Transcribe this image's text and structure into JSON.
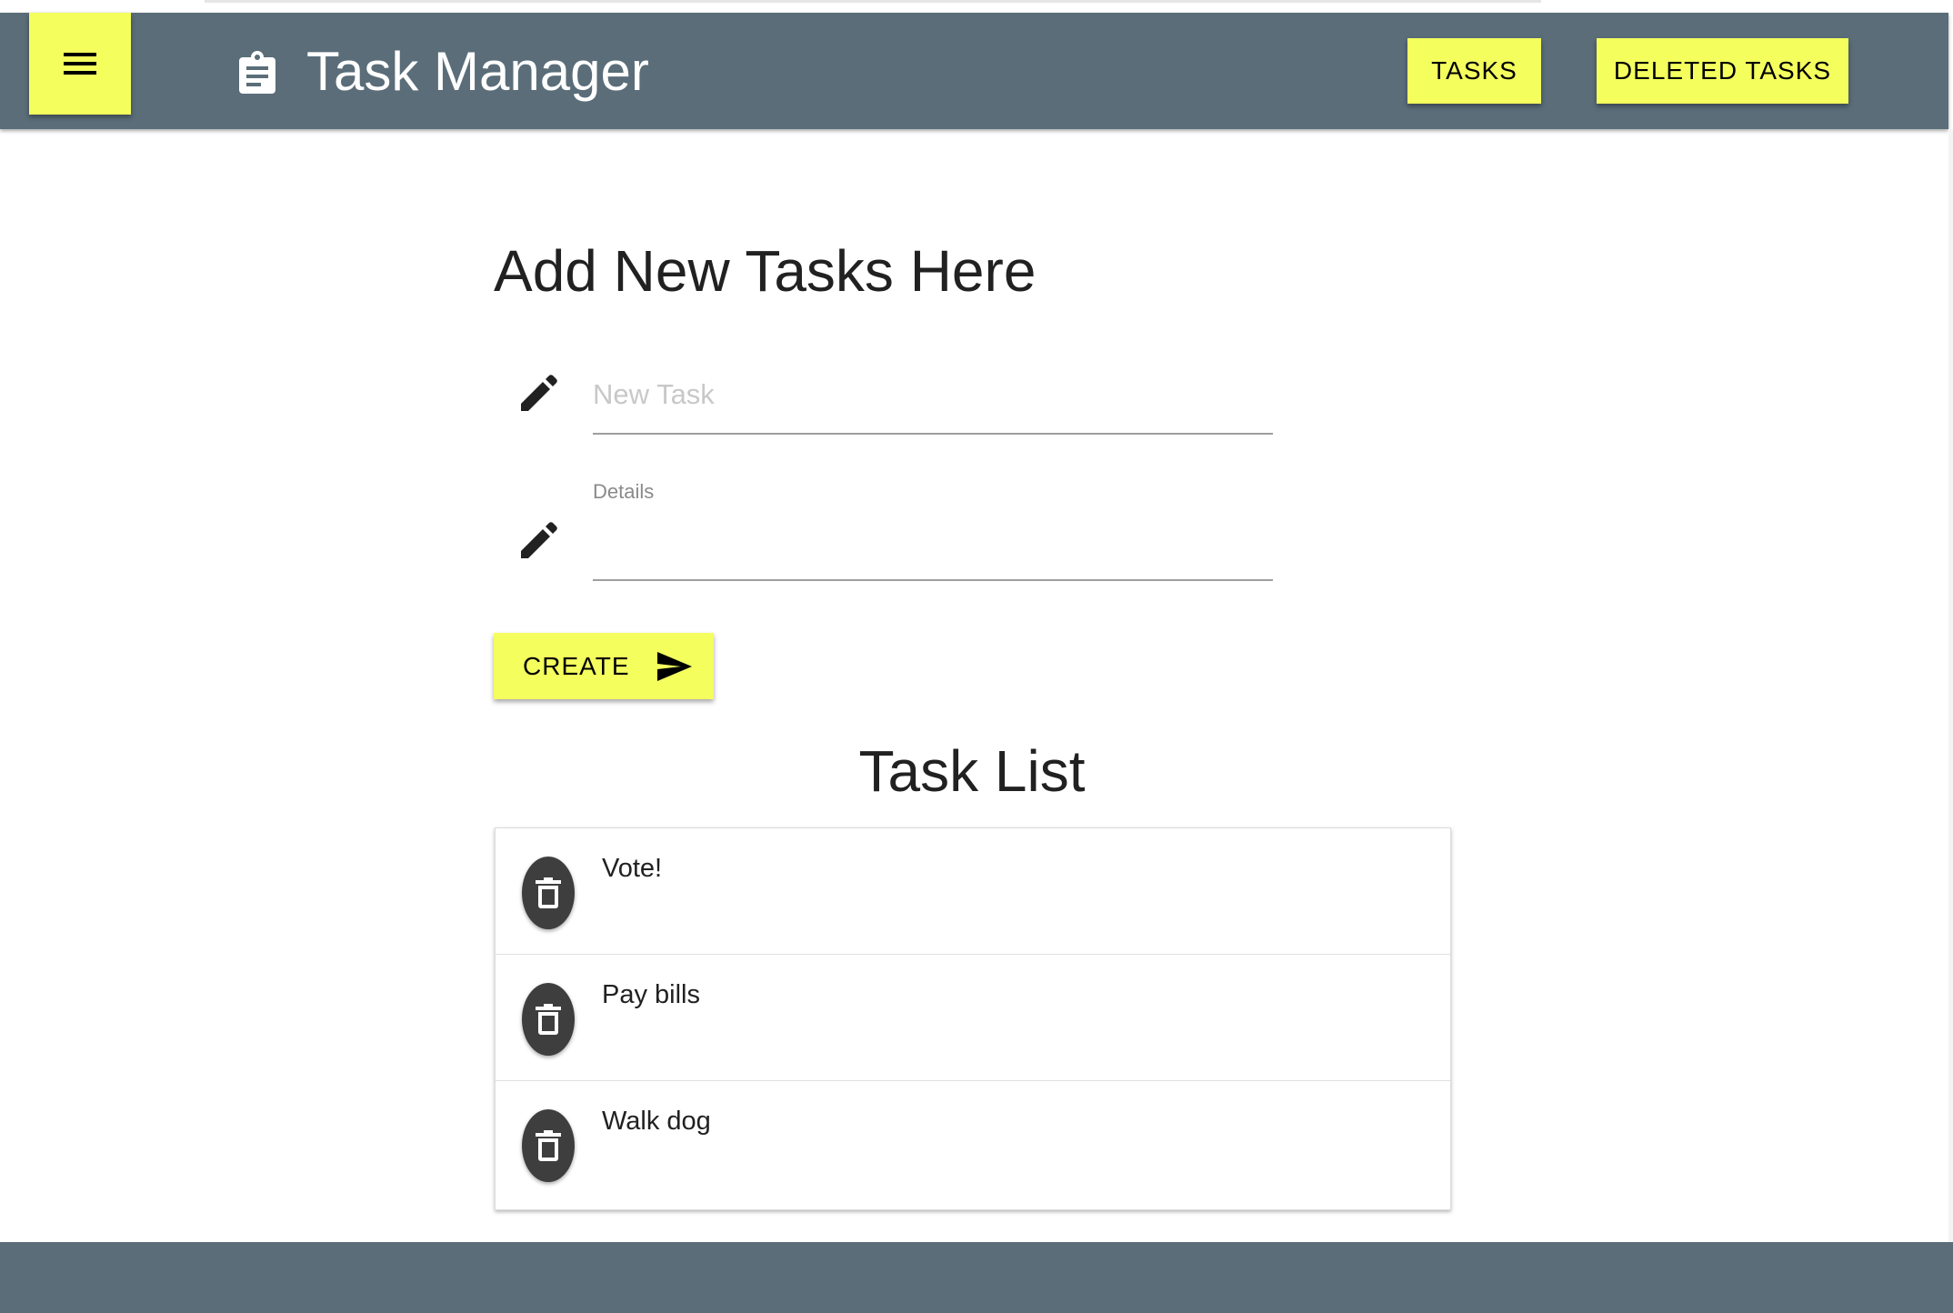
{
  "header": {
    "title": "Task Manager",
    "menu_icon": "menu-icon",
    "brand_icon": "clipboard-icon",
    "nav": {
      "tasks_label": "TASKS",
      "deleted_tasks_label": "DELETED TASKS"
    }
  },
  "form": {
    "heading": "Add New Tasks Here",
    "task_field": {
      "placeholder": "New Task",
      "value": "",
      "icon": "pencil-icon"
    },
    "details_field": {
      "label": "Details",
      "value": "",
      "icon": "pencil-icon"
    },
    "create_button": {
      "label": "CREATE",
      "icon": "send-icon"
    }
  },
  "task_list": {
    "heading": "Task List",
    "delete_icon": "trash-icon",
    "items": [
      {
        "title": "Vote!"
      },
      {
        "title": "Pay bills"
      },
      {
        "title": "Walk dog"
      }
    ]
  },
  "colors": {
    "header_background": "#5a6d79",
    "accent_button": "#f4ff5e",
    "delete_button": "#3e3e3e",
    "text": "#212121"
  }
}
